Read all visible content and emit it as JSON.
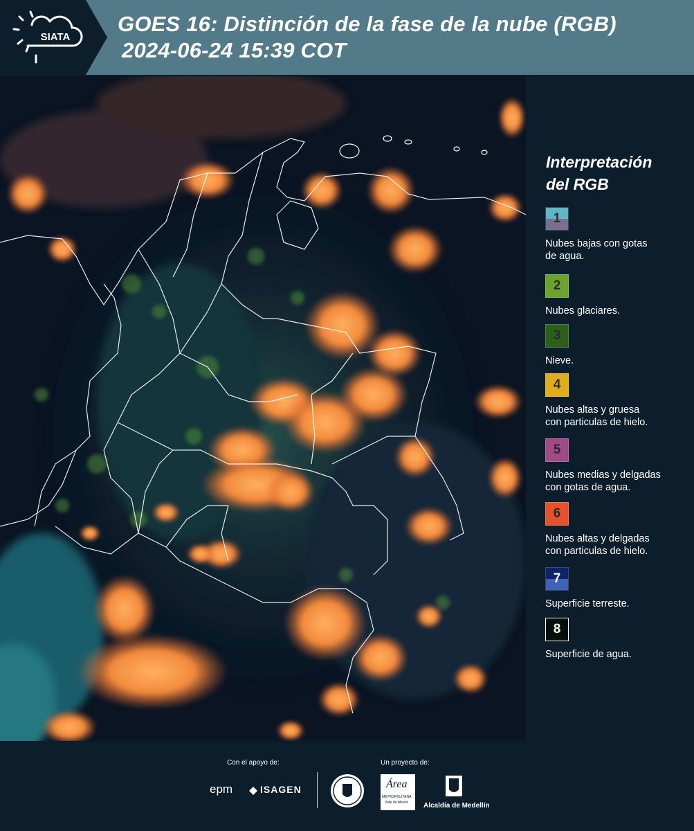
{
  "header": {
    "logo_text": "SIATA",
    "title_line1": "GOES 16: Distinción de la fase de la nube (RGB)",
    "title_line2": "2024-06-24 15:39 COT"
  },
  "legend": {
    "title_line1": "Interpretación",
    "title_line2": "del RGB",
    "items": [
      {
        "num": "1",
        "top_color": "#5eb6c6",
        "bottom_color": "#7a6f8e",
        "desc_line1": "Nubes bajas con gotas",
        "desc_line2": "de agua."
      },
      {
        "num": "2",
        "top_color": "#6aa42e",
        "bottom_color": "#6aa42e",
        "desc_line1": "Nubes glaciares.",
        "desc_line2": ""
      },
      {
        "num": "3",
        "top_color": "#2d5f1c",
        "bottom_color": "#2d5f1c",
        "desc_line1": "Nieve.",
        "desc_line2": ""
      },
      {
        "num": "4",
        "top_color": "#e0ad1c",
        "bottom_color": "#e0ad1c",
        "desc_line1": "Nubes altas y gruesa",
        "desc_line2": "con particulas de hielo."
      },
      {
        "num": "5",
        "top_color": "#a04a86",
        "bottom_color": "#a04a86",
        "desc_line1": "Nubes medias y delgadas",
        "desc_line2": "con gotas de agua."
      },
      {
        "num": "6",
        "top_color": "#e5532e",
        "bottom_color": "#e5532e",
        "desc_line1": "Nubes altas y delgadas",
        "desc_line2": "con particulas de hielo."
      },
      {
        "num": "7",
        "top_color": "#10226a",
        "bottom_color": "#3d62b8",
        "desc_line1": "Superficie terreste.",
        "desc_line2": ""
      },
      {
        "num": "8",
        "top_color": "#06100a",
        "bottom_color": "#06100a",
        "desc_line1": "Superficie de agua.",
        "desc_line2": ""
      }
    ]
  },
  "footer": {
    "support_label": "Con el apoyo de:",
    "project_label": "Un proyecto de:",
    "epm": "epm",
    "isagen": "ISAGEN",
    "area_main": "Área",
    "area_sub1": "METROPOLITANA",
    "area_sub2": "Valle de Aburrá",
    "alcaldia": "Alcaldía de Medellín"
  }
}
